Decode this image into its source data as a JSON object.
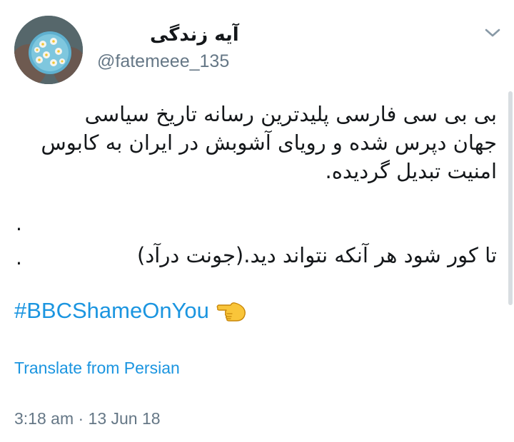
{
  "user": {
    "display_name": "آیه زندگی",
    "handle": "@fatemeee_135"
  },
  "tweet": {
    "lines": [
      "بی بی سی فارسی پلیدترین رسانه تاریخ سیاسی",
      "جهان دپرس شده و رویای آشوبش در ایران به کابوس",
      "امنیت تبدیل گردیده."
    ],
    "dots": [
      ".",
      "."
    ],
    "quote_line": "تا کور شود هر آنکه نتواند دید.(جونت درآد)",
    "hashtag": "#BBCShameOnYou",
    "emoji_icon": "backhand-index-pointing-left-icon"
  },
  "translate_label": "Translate from Persian",
  "timestamp": "3:18 am · 13 Jun 18",
  "colors": {
    "link": "#1b95e0",
    "secondary_text": "#657786",
    "primary_text": "#14171a"
  }
}
